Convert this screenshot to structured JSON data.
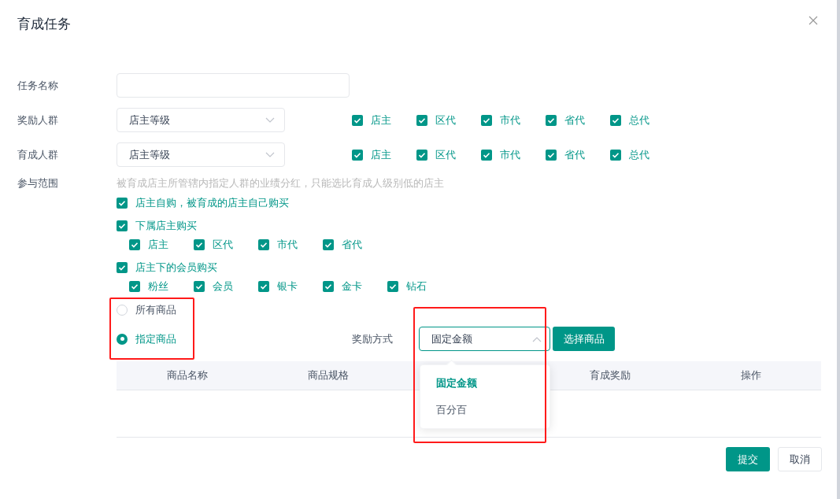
{
  "dialog": {
    "title": "育成任务"
  },
  "task_name": {
    "label": "任务名称"
  },
  "reward_group": {
    "label": "奖励人群",
    "select": "店主等级",
    "options": [
      {
        "label": "店主",
        "checked": true
      },
      {
        "label": "区代",
        "checked": true
      },
      {
        "label": "市代",
        "checked": true
      },
      {
        "label": "省代",
        "checked": true
      },
      {
        "label": "总代",
        "checked": true
      }
    ]
  },
  "cultivate_group": {
    "label": "育成人群",
    "select": "店主等级",
    "options": [
      {
        "label": "店主",
        "checked": true
      },
      {
        "label": "区代",
        "checked": true
      },
      {
        "label": "市代",
        "checked": true
      },
      {
        "label": "省代",
        "checked": true
      },
      {
        "label": "总代",
        "checked": true
      }
    ]
  },
  "scope": {
    "label": "参与范围",
    "hint": "被育成店主所管辖内指定人群的业绩分红，只能选比育成人级别低的店主",
    "items": [
      {
        "label": "店主自购，被育成的店主自己购买",
        "checked": true
      },
      {
        "label": "下属店主购买",
        "checked": true,
        "children": [
          {
            "label": "店主",
            "checked": true
          },
          {
            "label": "区代",
            "checked": true
          },
          {
            "label": "市代",
            "checked": true
          },
          {
            "label": "省代",
            "checked": true
          }
        ]
      },
      {
        "label": "店主下的会员购买",
        "checked": true,
        "children": [
          {
            "label": "粉丝",
            "checked": true
          },
          {
            "label": "会员",
            "checked": true
          },
          {
            "label": "银卡",
            "checked": true
          },
          {
            "label": "金卡",
            "checked": true
          },
          {
            "label": "钻石",
            "checked": true
          }
        ]
      }
    ]
  },
  "goods_scope": {
    "highlighted": true,
    "options": [
      {
        "label": "所有商品",
        "selected": false
      },
      {
        "label": "指定商品",
        "selected": true
      }
    ]
  },
  "reward_method": {
    "label": "奖励方式",
    "value": "固定金额",
    "expanded": true,
    "highlighted": true,
    "options": [
      {
        "label": "固定金额",
        "selected": true
      },
      {
        "label": "百分百",
        "selected": false
      }
    ]
  },
  "select_goods_button": "选择商品",
  "table": {
    "columns": [
      {
        "label": "商品名称"
      },
      {
        "label": "商品规格"
      },
      {},
      {
        "label": "育成奖励"
      },
      {
        "label": "操作"
      }
    ]
  },
  "buttons": [
    {
      "label": "提交",
      "kind": "primary"
    },
    {
      "label": "取消",
      "kind": "default"
    }
  ]
}
